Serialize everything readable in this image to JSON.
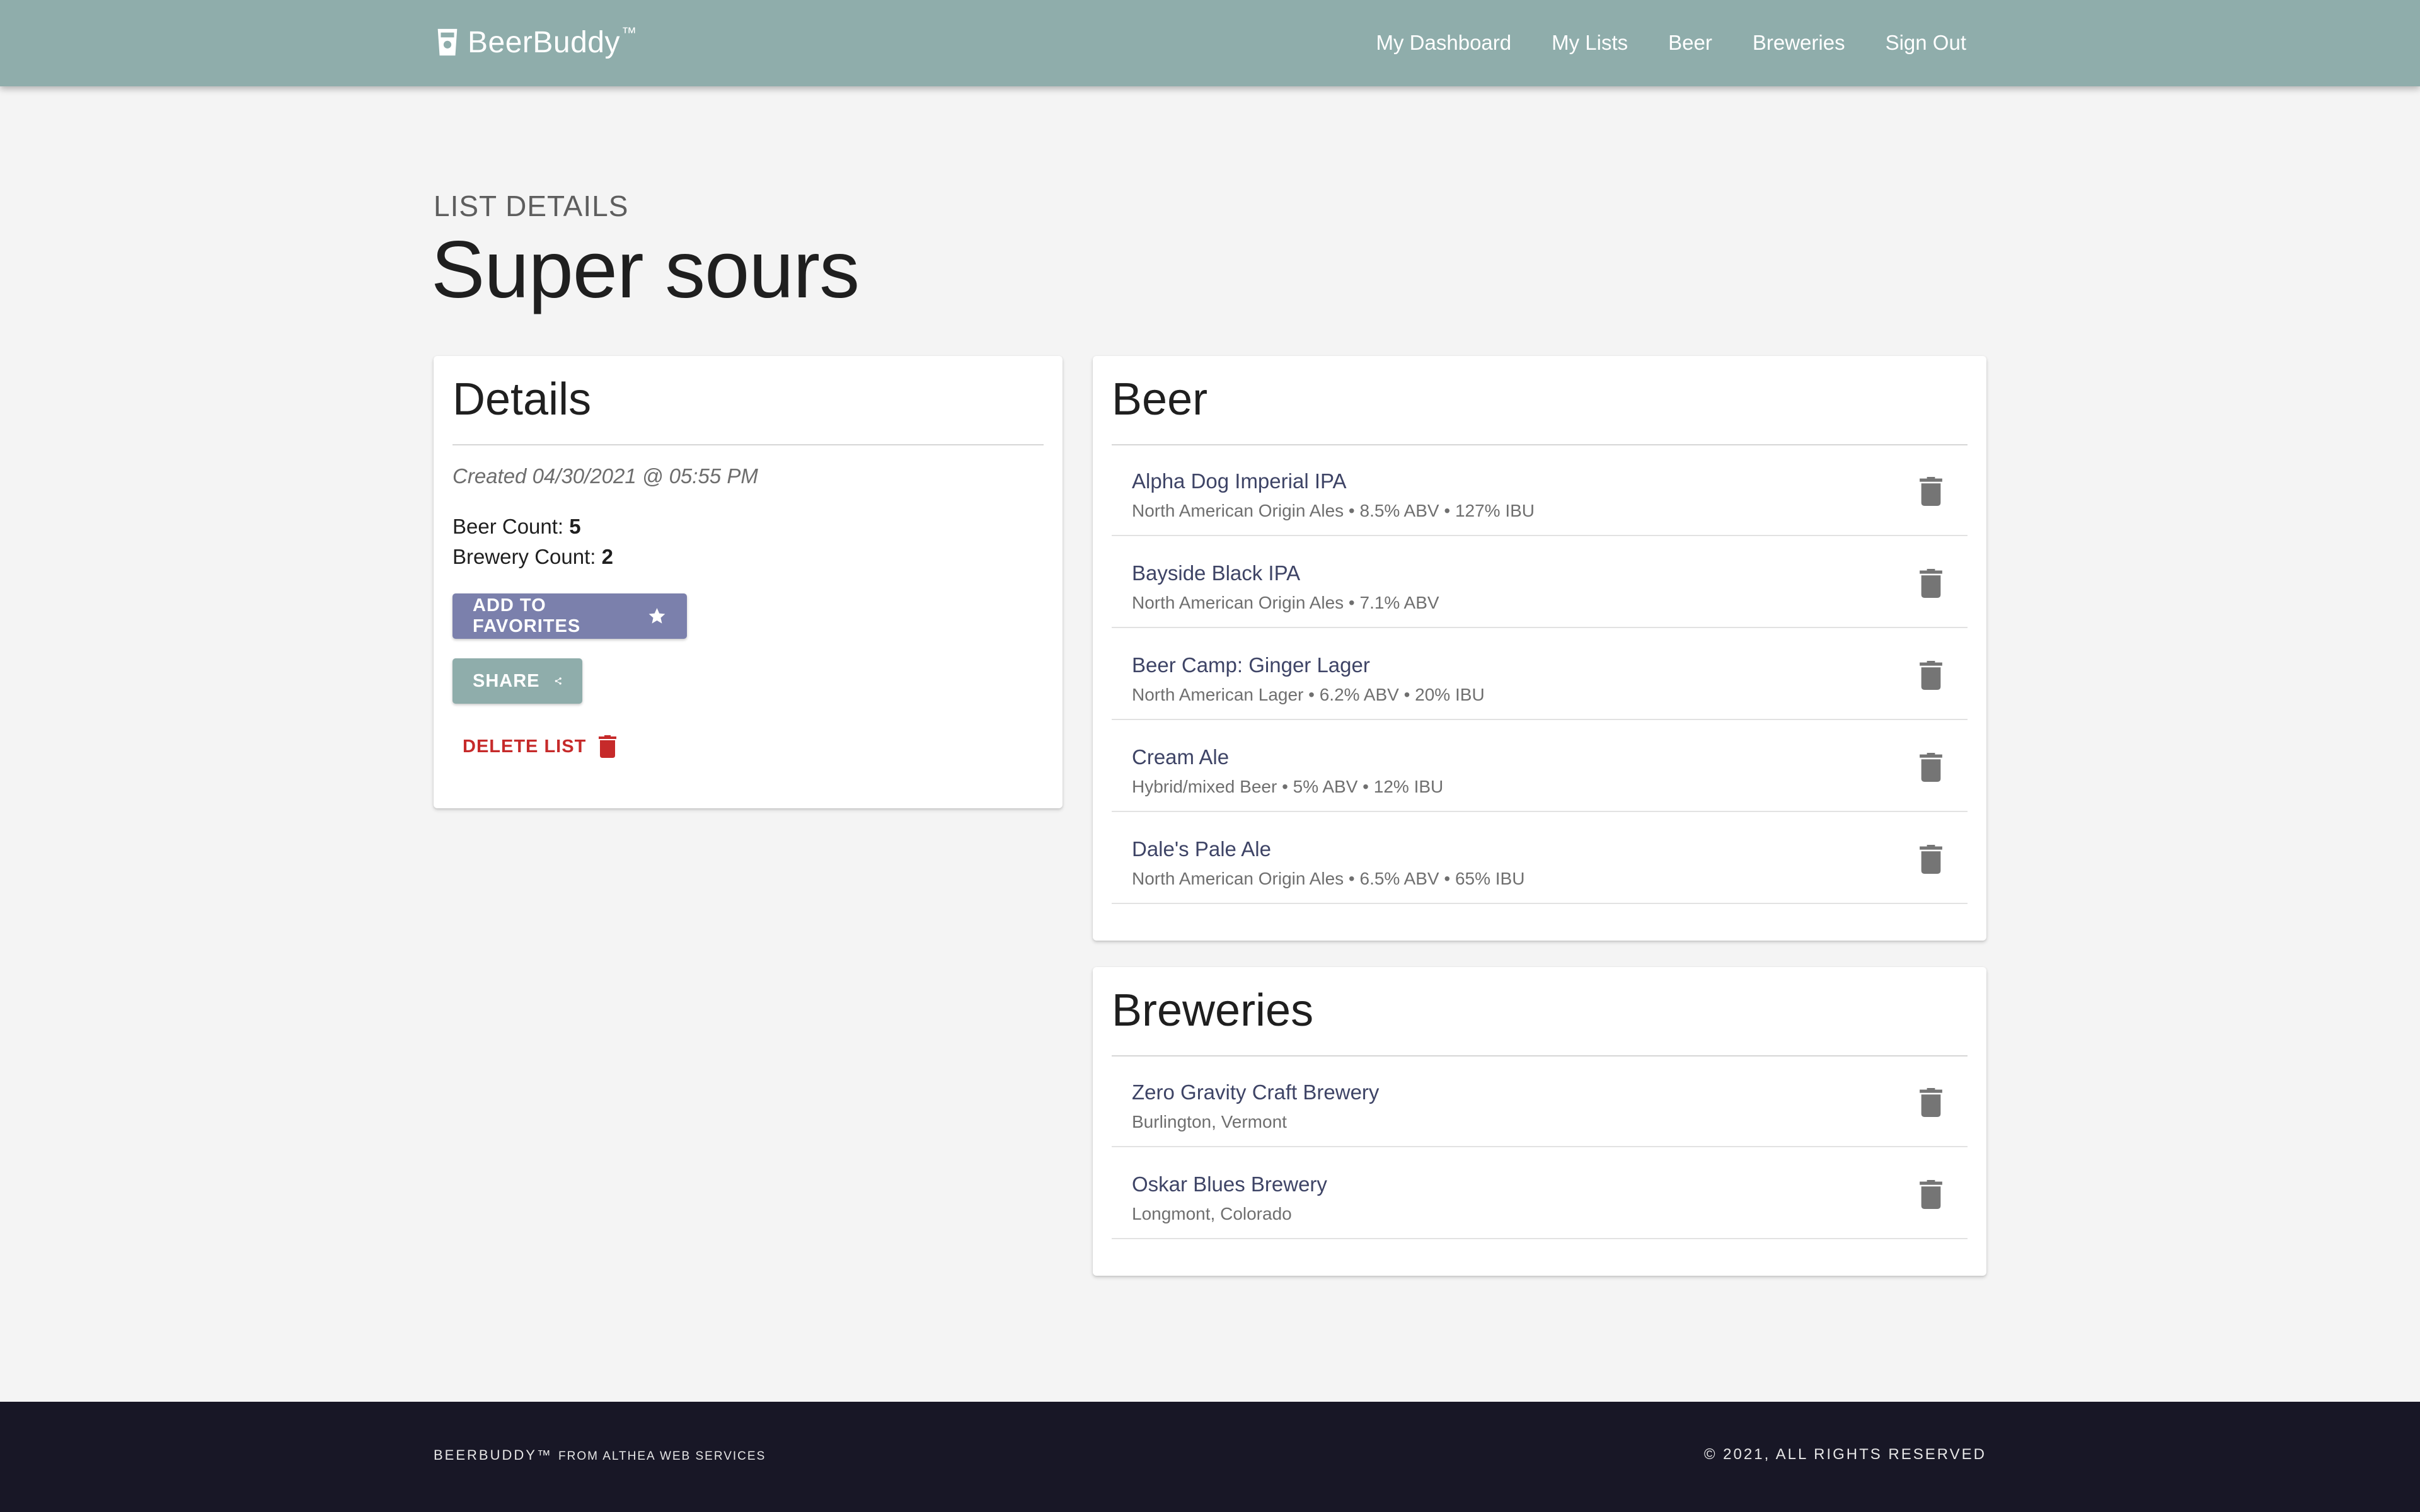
{
  "header": {
    "brand_name": "BeerBuddy",
    "brand_mark": "™",
    "brand_icon": "beer-cup-icon",
    "bar_color": "#8fadab",
    "nav": [
      {
        "label": "My Dashboard"
      },
      {
        "label": "My Lists"
      },
      {
        "label": "Beer"
      },
      {
        "label": "Breweries"
      },
      {
        "label": "Sign Out"
      }
    ]
  },
  "page": {
    "eyebrow": "LIST DETAILS",
    "title": "Super sours"
  },
  "details": {
    "heading": "Details",
    "created": "Created 04/30/2021 @ 05:55 PM",
    "beer_count_label": "Beer Count:",
    "beer_count": "5",
    "brewery_count_label": "Brewery Count:",
    "brewery_count": "2",
    "favorites_label": "ADD TO FAVORITES",
    "favorites_icon": "star-icon",
    "favorites_color": "#7b80ac",
    "share_label": "SHARE",
    "share_icon": "share-icon",
    "delete_label": "DELETE LIST",
    "delete_icon": "trash-icon",
    "delete_color": "#c62a2a"
  },
  "beer": {
    "heading": "Beer",
    "items": [
      {
        "name": "Alpha Dog Imperial IPA",
        "meta": "North American Origin Ales • 8.5% ABV • 127% IBU"
      },
      {
        "name": "Bayside Black IPA",
        "meta": "North American Origin Ales • 7.1% ABV"
      },
      {
        "name": "Beer Camp: Ginger Lager",
        "meta": "North American Lager • 6.2% ABV • 20% IBU"
      },
      {
        "name": "Cream Ale",
        "meta": "Hybrid/mixed Beer • 5% ABV • 12% IBU"
      },
      {
        "name": "Dale's Pale Ale",
        "meta": "North American Origin Ales • 6.5% ABV • 65% IBU"
      }
    ]
  },
  "breweries": {
    "heading": "Breweries",
    "items": [
      {
        "name": "Zero Gravity Craft Brewery",
        "meta": "Burlington, Vermont"
      },
      {
        "name": "Oskar Blues Brewery",
        "meta": "Longmont, Colorado"
      }
    ]
  },
  "footer": {
    "brand": "BEERBUDDY™",
    "from": "FROM ALTHEA WEB SERVICES",
    "copyright": "© 2021, ALL RIGHTS RESERVED",
    "background": "#181726"
  }
}
